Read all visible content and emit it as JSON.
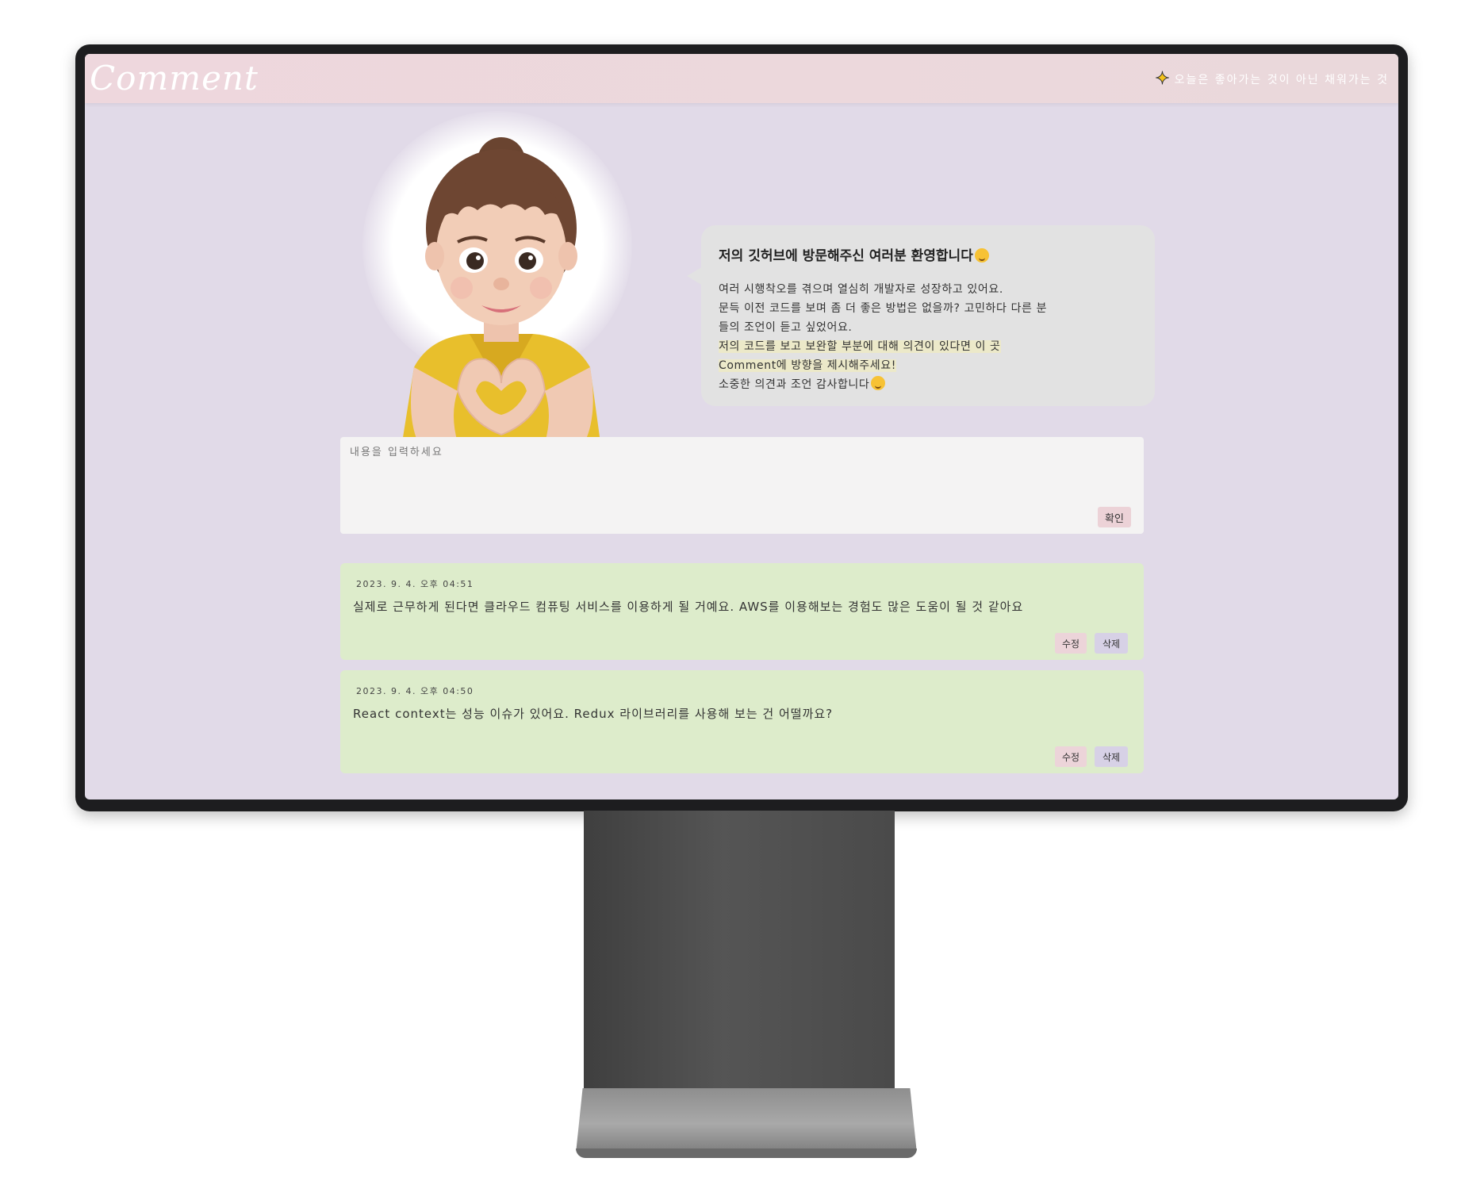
{
  "header": {
    "logo": "Comment",
    "motto": "오늘은 좋아가는 것이 아닌 채워가는 것",
    "motto_icon": "sparkle-icon"
  },
  "intro": {
    "title": "저의 깃허브에 방문해주신 여러분 환영합니다",
    "lines": [
      "여러 시행착오를 겪으며 열심히 개발자로 성장하고 있어요.",
      "문득 이전 코드를 보며 좀 더 좋은 방법은 없을까? 고민하다 다른 분",
      "들의 조언이 듣고 싶었어요.",
      "저의 코드를 보고 보완할 부분에 대해 의견이 있다면 이 곳",
      "Comment에 방향을 제시해주세요!",
      "소중한 의견과 조언 감사합니다"
    ]
  },
  "form": {
    "placeholder": "내용을 입력하세요",
    "value": "",
    "submit_label": "확인"
  },
  "comments": [
    {
      "timestamp": "2023. 9. 4. 오후 04:51",
      "text": "실제로 근무하게 된다면 클라우드 컴퓨팅 서비스를 이용하게 될 거예요. AWS를 이용해보는 경험도 많은 도움이 될 것 같아요",
      "edit_label": "수정",
      "delete_label": "삭제"
    },
    {
      "timestamp": "2023. 9. 4. 오후 04:50",
      "text": "React context는 성능 이슈가 있어요. Redux 라이브러리를 사용해 보는 건 어떨까요?",
      "edit_label": "수정",
      "delete_label": "삭제"
    }
  ],
  "colors": {
    "header": "#eed7dd",
    "background": "#e1dae8",
    "comment_card": "#ddeccb",
    "edit_button": "#ecd4d9",
    "delete_button": "#d7d1e6"
  }
}
